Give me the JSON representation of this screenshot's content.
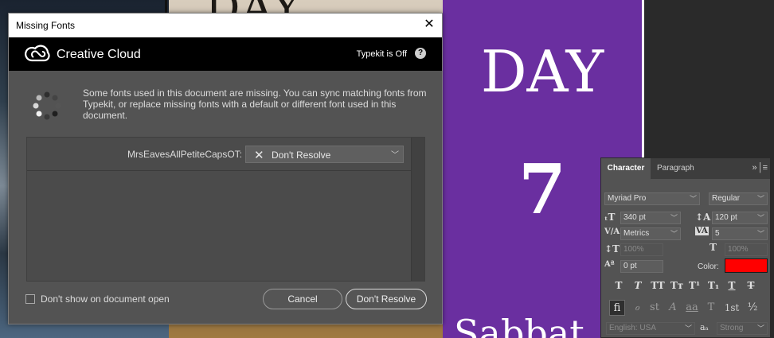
{
  "background": {
    "photo_title": "DAY",
    "poster_day": "DAY",
    "poster_number": "7",
    "poster_bottom": "Sabbat",
    "poster_color": "#6a2fa0"
  },
  "dialog": {
    "title": "Missing Fonts",
    "close_icon": "close-icon",
    "brand": "Creative Cloud",
    "typekit_status": "Typekit is Off",
    "help_icon": "?",
    "message": "Some fonts used in this document are missing. You can sync matching fonts from Typekit, or replace missing fonts with a default or different font used in this document.",
    "missing_fonts": [
      {
        "name": "MrsEavesAllPetiteCapsOT:",
        "resolution": "Don't Resolve"
      }
    ],
    "dont_show_label": "Don't show on document open",
    "dont_show_checked": false,
    "cancel_label": "Cancel",
    "dont_resolve_label": "Don't Resolve"
  },
  "character_panel": {
    "tabs": [
      "Character",
      "Paragraph"
    ],
    "font_family": "Myriad Pro",
    "font_style": "Regular",
    "font_size": "340 pt",
    "leading": "120 pt",
    "kerning": "Metrics",
    "tracking": "5",
    "vertical_scale": "100%",
    "horizontal_scale": "100%",
    "baseline_shift": "0 pt",
    "color_label": "Color:",
    "color": "#ff0000",
    "style_buttons": [
      "T",
      "T",
      "TT",
      "Tт",
      "T¹",
      "T₁",
      "T",
      "T"
    ],
    "opentype_buttons": [
      "fi",
      "ℴ",
      "st",
      "A",
      "aa",
      "T",
      "1st",
      "½"
    ],
    "language": "English: USA",
    "aa_label": "aₐ",
    "antialias": "Strong"
  }
}
